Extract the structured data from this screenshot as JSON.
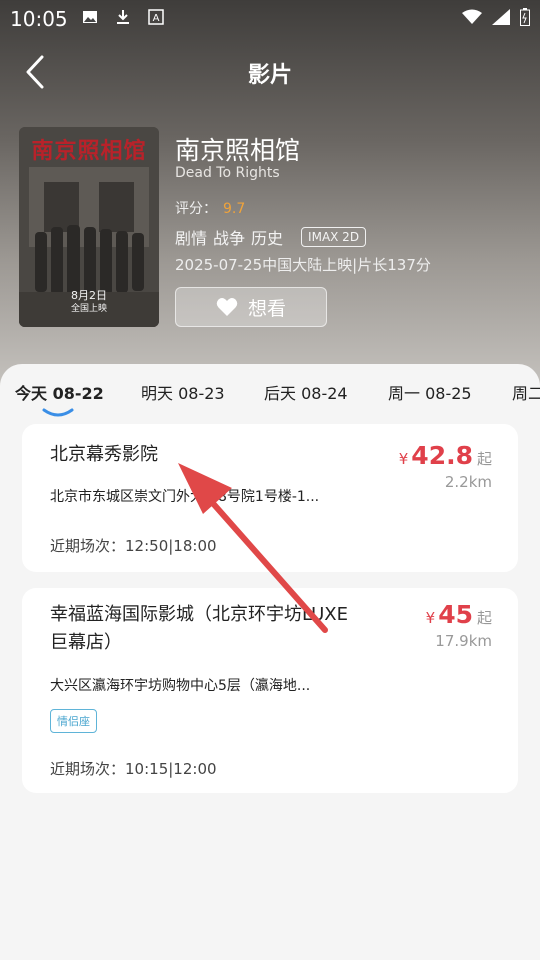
{
  "status_bar": {
    "time": "10:05"
  },
  "header": {
    "title": "影片"
  },
  "movie": {
    "title": "南京照相馆",
    "english_title": "Dead To Rights",
    "rating_label": "评分：",
    "rating_value": "9.7",
    "genres": [
      "剧情",
      "战争",
      "历史"
    ],
    "format_badge": "IMAX 2D",
    "release_info": "2025-07-25中国大陆上映|片长137分",
    "want_button_label": "想看",
    "poster_text": {
      "title": "南京照相馆",
      "date": "8月2日",
      "subtitle": "全国上映"
    }
  },
  "date_tabs": [
    {
      "label": "今天 08-22",
      "active": true
    },
    {
      "label": "明天 08-23",
      "active": false
    },
    {
      "label": "后天 08-24",
      "active": false
    },
    {
      "label": "周一 08-25",
      "active": false
    },
    {
      "label": "周二",
      "active": false
    }
  ],
  "cinemas": [
    {
      "name": "北京幕秀影院",
      "address": "北京市东城区崇文门外大街8号院1号楼-1...",
      "recent_label": "近期场次：",
      "showtimes": "12:50|18:00",
      "price_symbol": "¥",
      "price": "42.8",
      "price_suffix": "起",
      "distance": "2.2km"
    },
    {
      "name_line1": "幸福蓝海国际影城（北京环宇坊LUXE",
      "name_line2": "巨幕店）",
      "address": "大兴区瀛海环宇坊购物中心5层（瀛海地...",
      "tag": "情侣座",
      "recent_label": "近期场次：",
      "showtimes": "10:15|12:00",
      "price_symbol": "¥",
      "price": "45",
      "price_suffix": "起",
      "distance": "17.9km"
    }
  ],
  "colors": {
    "price": "#e0404a",
    "rating": "#f0a33a",
    "annotation_arrow": "#e04848"
  }
}
